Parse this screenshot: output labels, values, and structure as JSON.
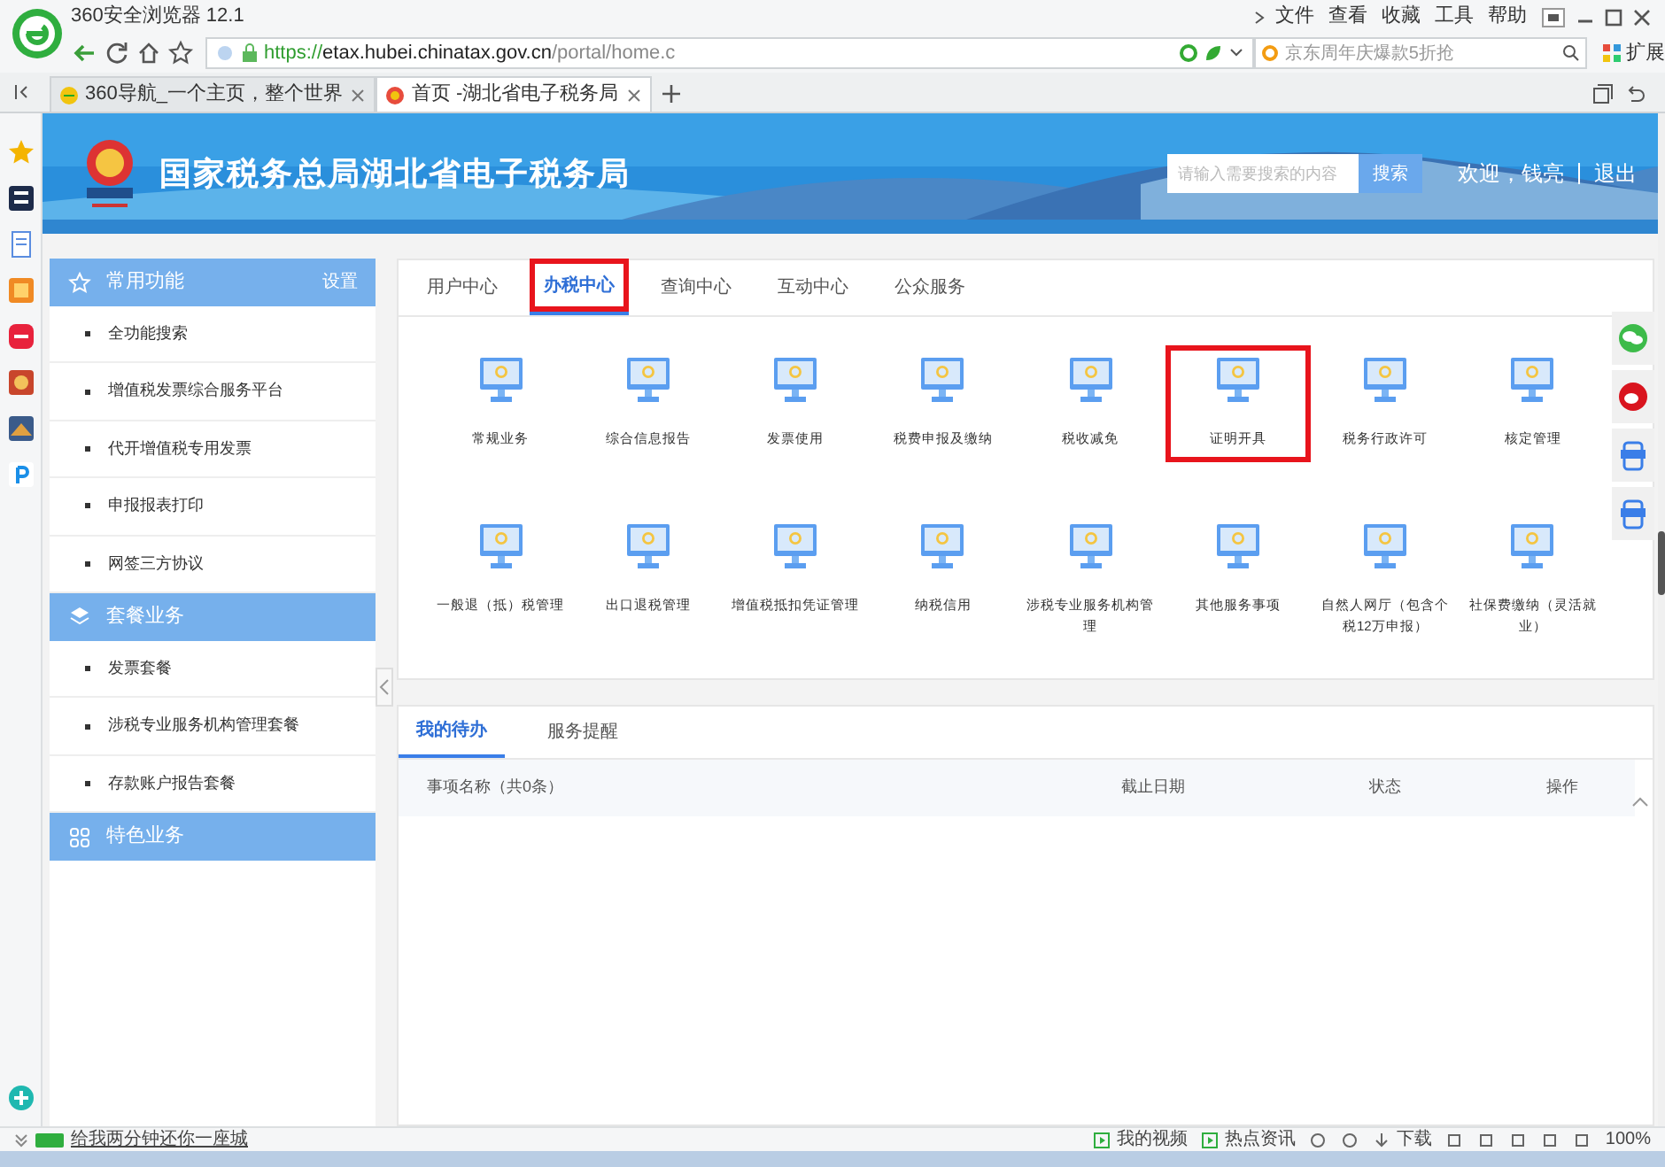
{
  "browser": {
    "title": "360安全浏览器 12.1",
    "menu": [
      "文件",
      "查看",
      "收藏",
      "工具",
      "帮助"
    ],
    "url_scheme": "https://",
    "url_host": "etax.hubei.chinatax.gov.cn",
    "url_path": "/portal/home.c",
    "search_placeholder": "京东周年庆爆款5折抢",
    "extensions_label": "扩展"
  },
  "tabs": [
    {
      "title": "360导航_一个主页，整个世界",
      "selected": false
    },
    {
      "title": "首页 -湖北省电子税务局",
      "selected": true
    }
  ],
  "site": {
    "title": "国家税务总局湖北省电子税务局",
    "search_placeholder": "请输入需要搜索的内容",
    "search_button": "搜索",
    "welcome": "欢迎，钱亮",
    "logout": "退出"
  },
  "sidebar": [
    {
      "title": "常用功能",
      "action": "设置",
      "items": [
        "全功能搜索",
        "增值税发票综合服务平台",
        "代开增值税专用发票",
        "申报报表打印",
        "网签三方协议"
      ]
    },
    {
      "title": "套餐业务",
      "items": [
        "发票套餐",
        "涉税专业服务机构管理套餐",
        "存款账户报告套餐"
      ]
    },
    {
      "title": "特色业务"
    }
  ],
  "main_tabs": [
    {
      "label": "用户中心",
      "selected": false,
      "highlighted": false
    },
    {
      "label": "办税中心",
      "selected": true,
      "highlighted": true
    },
    {
      "label": "查询中心",
      "selected": false,
      "highlighted": false
    },
    {
      "label": "互动中心",
      "selected": false,
      "highlighted": false
    },
    {
      "label": "公众服务",
      "selected": false,
      "highlighted": false
    }
  ],
  "services": [
    {
      "label": "常规业务",
      "highlighted": false
    },
    {
      "label": "综合信息报告",
      "highlighted": false
    },
    {
      "label": "发票使用",
      "highlighted": false
    },
    {
      "label": "税费申报及缴纳",
      "highlighted": false
    },
    {
      "label": "税收减免",
      "highlighted": false
    },
    {
      "label": "证明开具",
      "highlighted": true
    },
    {
      "label": "税务行政许可",
      "highlighted": false
    },
    {
      "label": "核定管理",
      "highlighted": false
    },
    {
      "label": "一般退（抵）税管理",
      "highlighted": false
    },
    {
      "label": "出口退税管理",
      "highlighted": false
    },
    {
      "label": "增值税抵扣凭证管理",
      "highlighted": false
    },
    {
      "label": "纳税信用",
      "highlighted": false
    },
    {
      "label": "涉税专业服务机构管理",
      "highlighted": false
    },
    {
      "label": "其他服务事项",
      "highlighted": false
    },
    {
      "label": "自然人网厅（包含个税12万申报）",
      "highlighted": false
    },
    {
      "label": "社保费缴纳（灵活就业）",
      "highlighted": false
    }
  ],
  "todo_tabs": [
    {
      "label": "我的待办",
      "selected": true
    },
    {
      "label": "服务提醒",
      "selected": false
    }
  ],
  "todo_table": {
    "columns": [
      "事项名称（共0条）",
      "截止日期",
      "状态",
      "操作"
    ]
  },
  "status_bar": {
    "news": "给我两分钟还你一座城",
    "items": [
      "我的视频",
      "热点资讯",
      "下载"
    ],
    "zoom": "100%"
  }
}
